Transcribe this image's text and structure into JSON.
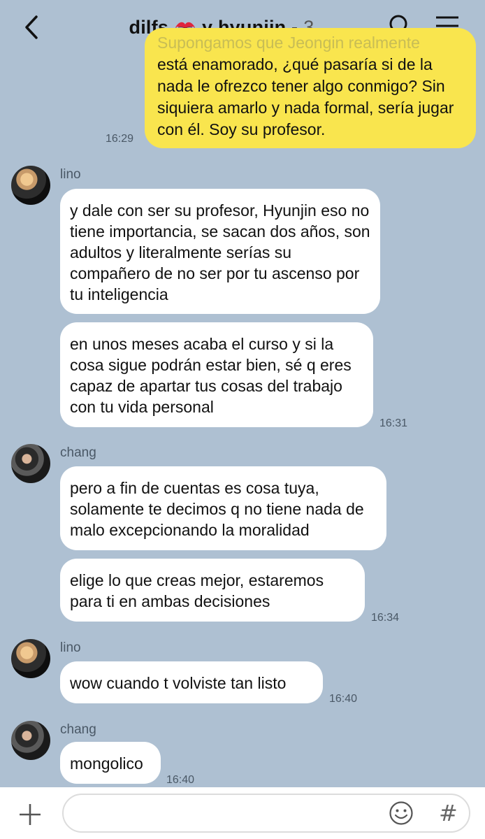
{
  "header": {
    "title": "dilfs",
    "title_after": "y hyunjin -",
    "member_count": "3",
    "back_icon": "chevron-left-icon",
    "emoji_icon": "kiss-mark-icon",
    "search_icon": "search-icon",
    "menu_icon": "hamburger-menu-icon"
  },
  "messages": {
    "me1": {
      "line0": "Supongamos que Jeongin realmente",
      "text": "está enamorado, ¿qué pasaría si de la nada le ofrezco tener algo conmigo? Sin siquiera amarlo y nada formal, sería jugar con él. Soy su profesor.",
      "time": "16:29"
    },
    "lino1": {
      "sender": "lino",
      "text1": "y dale con ser su profesor, Hyunjin eso no tiene importancia, se sacan dos años, son adultos y literalmente serías su compañero de no ser por tu ascenso por tu inteligencia",
      "text2": "en unos meses acaba el curso y si la cosa sigue podrán estar bien, sé q eres capaz de apartar tus cosas del trabajo con tu vida personal",
      "time": "16:31"
    },
    "chang1": {
      "sender": "chang",
      "text1": "pero a fin de cuentas es cosa tuya, solamente te decimos q no tiene nada de malo excepcionando la moralidad",
      "text2": "elige lo que creas mejor, estaremos para ti en ambas decisiones",
      "time": "16:34"
    },
    "lino2": {
      "sender": "lino",
      "text": "wow cuando t volviste tan listo",
      "time": "16:40"
    },
    "chang2": {
      "sender": "chang",
      "text": "mongolico",
      "time": "16:40"
    }
  },
  "input_bar": {
    "plus_icon": "plus-icon",
    "emoji_icon": "smiley-icon",
    "hashtag_icon": "hashtag-icon",
    "hashtag_glyph": "#",
    "placeholder": ""
  },
  "colors": {
    "background": "#aec0d2",
    "my_bubble": "#f9e54e",
    "other_bubble": "#ffffff"
  }
}
